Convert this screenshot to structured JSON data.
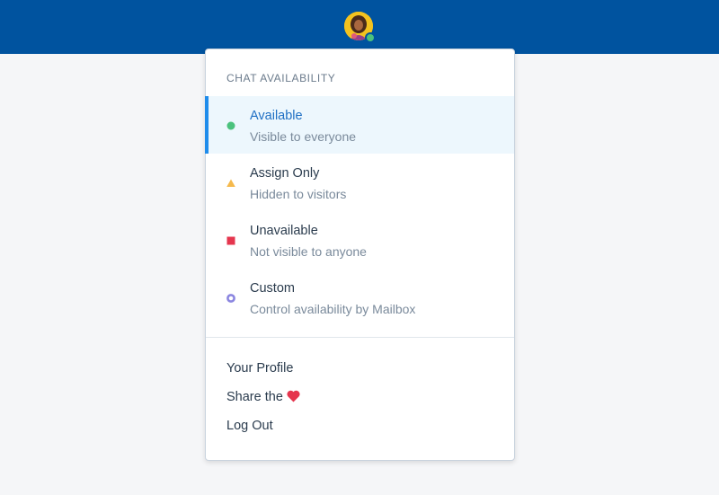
{
  "header": {
    "avatar_icon": "user-avatar-icon",
    "presence_color": "#4bc27d",
    "bar_color": "#00539f"
  },
  "menu": {
    "heading": "CHAT AVAILABILITY",
    "statuses": [
      {
        "title": "Available",
        "subtitle": "Visible to everyone",
        "icon": "green-dot-icon",
        "color": "#4bc27d",
        "selected": true
      },
      {
        "title": "Assign Only",
        "subtitle": "Hidden to visitors",
        "icon": "yellow-triangle-icon",
        "color": "#f5b94c",
        "selected": false
      },
      {
        "title": "Unavailable",
        "subtitle": "Not visible to anyone",
        "icon": "red-square-icon",
        "color": "#e5364e",
        "selected": false
      },
      {
        "title": "Custom",
        "subtitle": "Control availability by Mailbox",
        "icon": "purple-ring-icon",
        "color": "#8b86e0",
        "selected": false
      }
    ],
    "links": {
      "profile": "Your Profile",
      "share": "Share the",
      "share_icon": "heart-icon",
      "logout": "Log Out"
    }
  }
}
